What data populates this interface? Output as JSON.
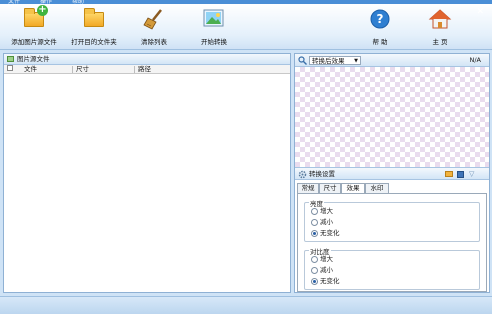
{
  "menu": [
    "文件",
    "操作",
    "帮助"
  ],
  "toolbar": {
    "add_source": "添加图片源文件",
    "open_target": "打开目的文件夹",
    "clear_list": "清除列表",
    "start_convert": "开始转换",
    "help": "帮 助",
    "home": "主 页"
  },
  "left_panel": {
    "title": "图片源文件",
    "columns": [
      "文件",
      "尺寸",
      "路径"
    ]
  },
  "right_panel": {
    "preview_select": "转换后效果",
    "ratio": "N/A",
    "settings_title": "转换设置",
    "tabs": [
      "常规",
      "尺寸",
      "效果",
      "水印"
    ],
    "active_tab": "效果",
    "brightness": {
      "title": "亮度",
      "options": [
        "增大",
        "减小",
        "无变化"
      ],
      "selected": "无变化"
    },
    "contrast": {
      "title": "对比度",
      "options": [
        "增大",
        "减小",
        "无变化"
      ],
      "selected": "无变化"
    }
  },
  "colors": {
    "accent": "#4a8ed6",
    "panel_border": "#8fb1d4",
    "checker": "#e9dcee"
  }
}
